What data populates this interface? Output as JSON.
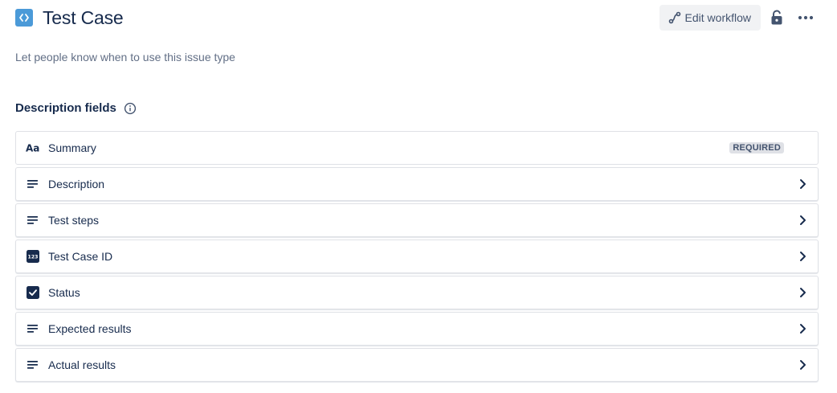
{
  "header": {
    "title": "Test Case",
    "edit_workflow_label": "Edit workflow",
    "issue_type_icon": "code-brackets-icon"
  },
  "description_hint": "Let people know when to use this issue type",
  "section": {
    "title": "Description fields"
  },
  "fields": [
    {
      "label": "Summary",
      "icon": "text-aa-icon",
      "badge": "REQUIRED"
    },
    {
      "label": "Description",
      "icon": "paragraph-lines-icon"
    },
    {
      "label": "Test steps",
      "icon": "paragraph-lines-icon"
    },
    {
      "label": "Test Case ID",
      "icon": "number-123-icon",
      "icon_text": "123"
    },
    {
      "label": "Status",
      "icon": "checkbox-icon"
    },
    {
      "label": "Expected results",
      "icon": "paragraph-lines-icon"
    },
    {
      "label": "Actual results",
      "icon": "paragraph-lines-icon"
    }
  ],
  "colors": {
    "issue_type_blue": "#4b9ad8",
    "text_primary": "#172b4d",
    "text_subtle": "#626f86",
    "button_bg": "#f1f2f4",
    "lozenge_bg": "#dfe1e6",
    "border": "#dfe1e6"
  }
}
